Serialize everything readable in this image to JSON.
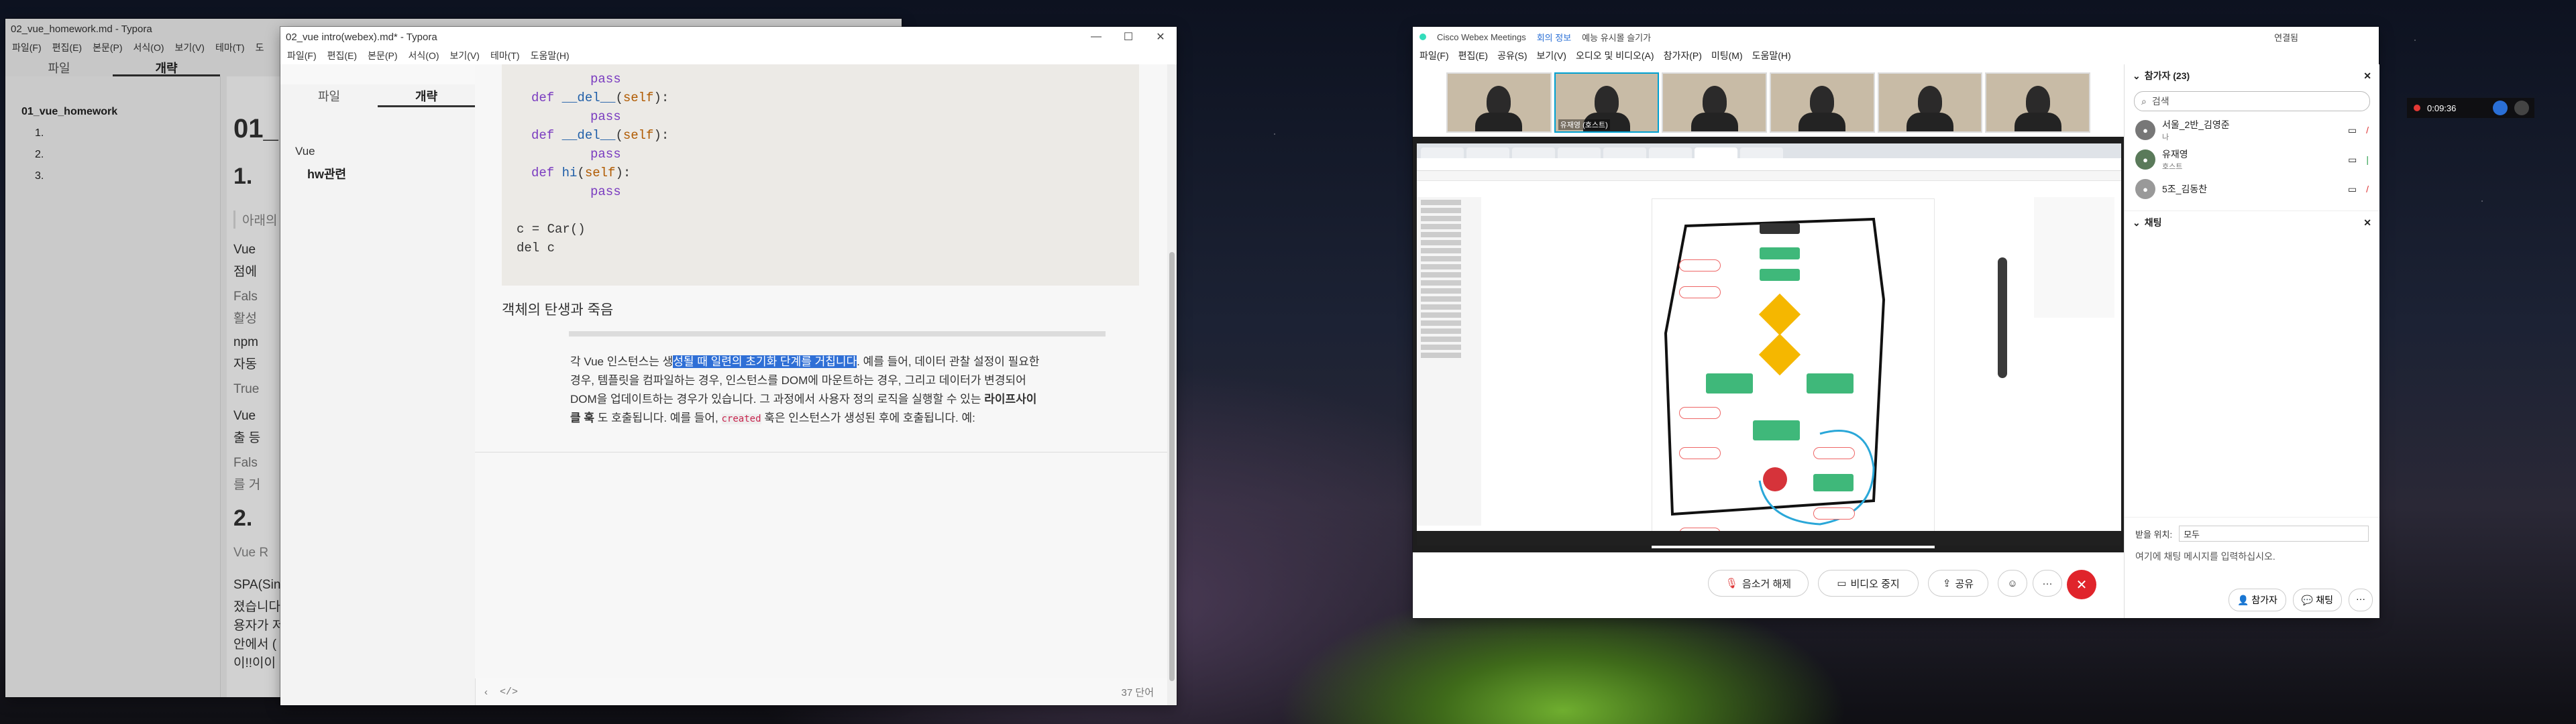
{
  "typora_back": {
    "title": "02_vue_homework.md - Typora",
    "menu": [
      "파일(F)",
      "편집(E)",
      "본문(P)",
      "서식(O)",
      "보기(V)",
      "테마(T)",
      "도"
    ],
    "tabs": [
      "파일",
      "개략"
    ],
    "outline": [
      "01_vue_homework",
      "1.",
      "2.",
      "3."
    ],
    "doc_h1": "01_",
    "doc_h2a": "1.",
    "doc_h2b": "2.",
    "frag": [
      "아래의",
      "Vue",
      "점에",
      "Fals",
      "활성",
      "npm",
      "자동",
      "True",
      "Vue",
      "출 등",
      "Fals",
      "를 거",
      "Vue R",
      "SPA(Sing",
      "졌습니다",
      "용자가 저",
      "안에서 (",
      "이!!이이"
    ]
  },
  "typora_front": {
    "title": "02_vue intro(webex).md* - Typora",
    "menu": [
      "파일(F)",
      "편집(E)",
      "본문(P)",
      "서식(O)",
      "보기(V)",
      "테마(T)",
      "도움말(H)"
    ],
    "tabs": [
      "파일",
      "개략"
    ],
    "outline": [
      "Vue",
      "hw관련"
    ],
    "code": {
      "pass1": "pass",
      "del1": "__del__",
      "self": "self",
      "pass2": "pass",
      "del2": "__del__",
      "pass3": "pass",
      "hi": "hi",
      "pass4": "pass",
      "c1": "c = Car()",
      "c2": "del c"
    },
    "heading": "객체의 탄생과 죽음",
    "para_pre": "각 Vue 인스턴스는 생",
    "para_hl": "성될 때 일련의 초기화 단계를 거칩니다",
    "para_post": ". 예를 들어, 데이터 관찰 설정이 필요한",
    "para_line2": "경우, 템플릿을 컴파일하는 경우, 인스턴스를 DOM에 마운트하는 경우, 그리고 데이터가 변경되어",
    "para_line3": "DOM을 업데이트하는 경우가 있습니다. 그 과정에서 사용자 정의 로직을 실행할 수 있는",
    "para_bold": "라이프사이",
    "para_line4a": "클 훅",
    "para_line4b": "도 호출됩니다. 예를 들어,",
    "para_code": "created",
    "para_line4c": "훅은 인스턴스가 생성된 후에 호출됩니다. 예:",
    "word_count": "37 단어"
  },
  "webex": {
    "title": "Cisco Webex Meetings",
    "title_tabs": [
      "회의 정보",
      "예능 유시몰 슬기가"
    ],
    "title_right": "연결됨",
    "menu": [
      "파일(F)",
      "편집(E)",
      "공유(S)",
      "보기(V)",
      "오디오 및 비디오(A)",
      "참가자(P)",
      "미팅(M)",
      "도움말(H)"
    ],
    "tile_label": "유재영 (호스트)",
    "controls": {
      "mute": "음소거 해제",
      "video": "비디오 중지",
      "share": "공유",
      "more": "···"
    },
    "participants_header": "참가자 (23)",
    "search_placeholder": "검색",
    "participants": [
      {
        "name": "서울_2반_김영준",
        "sub": "나"
      },
      {
        "name": "유재영",
        "sub": "호스트"
      },
      {
        "name": "5조_김동찬",
        "sub": ""
      }
    ],
    "chat_header": "채팅",
    "chat_to_label": "받을 위치:",
    "chat_to_value": "모두",
    "chat_placeholder": "여기에 채팅 메시지를 입력하십시오.",
    "footer_participants": "참가자",
    "footer_chat": "채팅"
  },
  "recorder": {
    "time": "0:09:36"
  }
}
